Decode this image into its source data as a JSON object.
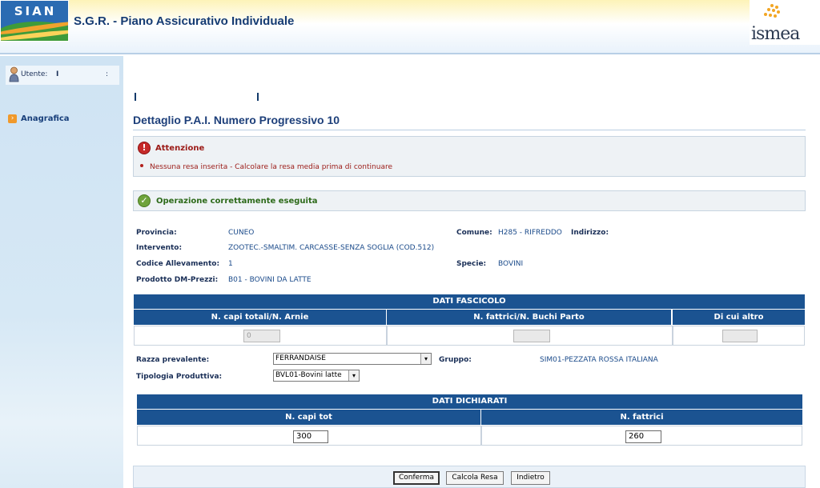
{
  "header": {
    "logo_text": "SIAN",
    "title": "S.G.R. - Piano Assicurativo Individuale",
    "partner_logo": "ismea"
  },
  "sidebar": {
    "user_label": "Utente:",
    "user_value": "I",
    "user_colon": ":",
    "menu": [
      {
        "label": "Anagrafica",
        "icon": "arrow-right-icon"
      }
    ]
  },
  "main": {
    "ticks": [
      "I",
      "I"
    ],
    "title": "Dettaglio P.A.I. Numero Progressivo 10",
    "warning": {
      "title": "Attenzione",
      "message": "Nessuna resa inserita - Calcolare la resa media prima di continuare"
    },
    "success": {
      "title": "Operazione correttamente eseguita"
    },
    "details": {
      "provincia_label": "Provincia:",
      "provincia": "CUNEO",
      "comune_label": "Comune:",
      "comune": "H285 - RIFREDDO",
      "indirizzo_label": "Indirizzo:",
      "intervento_label": "Intervento:",
      "intervento": "ZOOTEC.-SMALTIM. CARCASSE-SENZA SOGLIA (COD.512)",
      "codice_label": "Codice Allevamento:",
      "codice": "1",
      "specie_label": "Specie:",
      "specie": "BOVINI",
      "prodotto_label": "Prodotto DM-Prezzi:",
      "prodotto": "B01 - BOVINI DA LATTE"
    },
    "fascicolo": {
      "title": "DATI FASCICOLO",
      "columns": [
        "N. capi totali/N. Arnie",
        "N. fattrici/N. Buchi Parto",
        "Di cui altro"
      ],
      "values": [
        "0",
        "",
        ""
      ]
    },
    "razza_label": "Razza prevalente:",
    "razza_value": "FERRANDAISE",
    "gruppo_label": "Gruppo:",
    "gruppo_value": "SIM01-PEZZATA ROSSA ITALIANA",
    "tipologia_label": "Tipologia Produttiva:",
    "tipologia_value": "BVL01-Bovini latte",
    "dichiarati": {
      "title": "DATI DICHIARATI",
      "columns": [
        "N. capi tot",
        "N. fattrici"
      ],
      "values": [
        "300",
        "260"
      ]
    },
    "buttons": {
      "confirm": "Conferma",
      "calc": "Calcola Resa",
      "back": "Indietro"
    }
  }
}
